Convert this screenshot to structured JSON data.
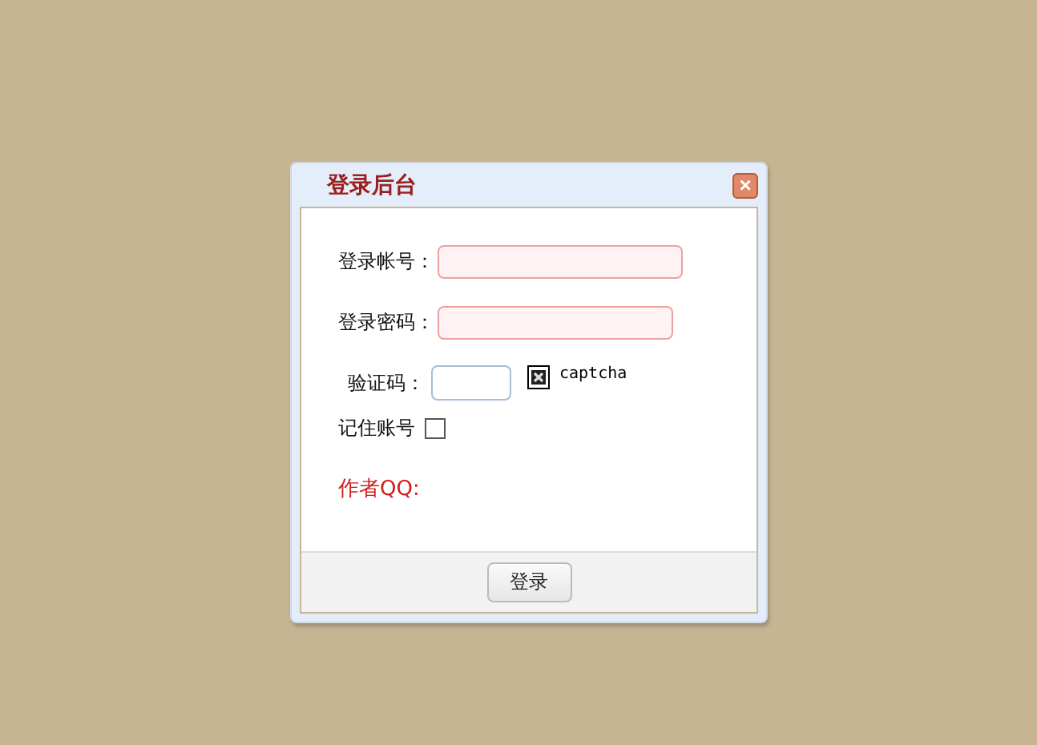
{
  "dialog": {
    "title": "登录后台",
    "close": "×"
  },
  "fields": [
    {
      "label": "登录帐号：",
      "kind": "text"
    },
    {
      "label": "登录密码：",
      "kind": "password"
    }
  ],
  "captcha": {
    "label": "验证码：",
    "image_alt": "captcha"
  },
  "remember": {
    "label": "记住账号",
    "checked": false
  },
  "author": "作者QQ:",
  "submit": "登录"
}
